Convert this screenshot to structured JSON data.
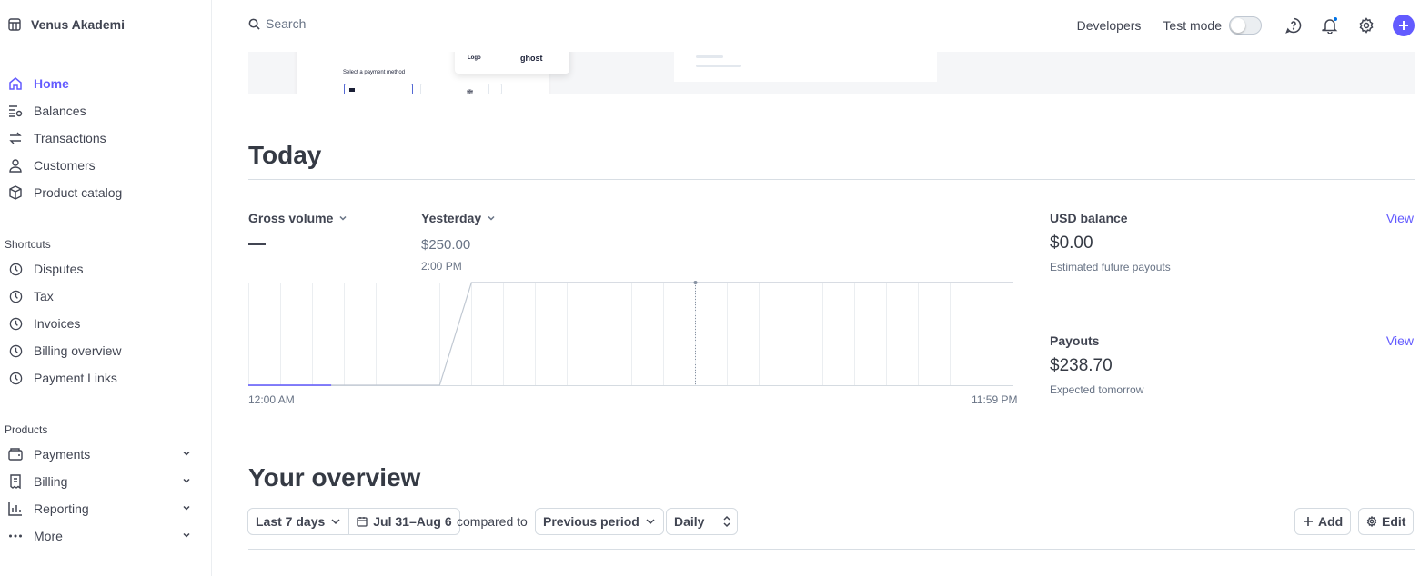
{
  "account": {
    "name": "Venus Akademi"
  },
  "nav": {
    "main": [
      {
        "label": "Home",
        "icon": "home-icon",
        "active": true
      },
      {
        "label": "Balances",
        "icon": "balances-icon"
      },
      {
        "label": "Transactions",
        "icon": "transactions-icon"
      },
      {
        "label": "Customers",
        "icon": "customers-icon"
      },
      {
        "label": "Product catalog",
        "icon": "product-catalog-icon"
      }
    ],
    "shortcuts_label": "Shortcuts",
    "shortcuts": [
      {
        "label": "Disputes",
        "icon": "clock-icon"
      },
      {
        "label": "Tax",
        "icon": "clock-icon"
      },
      {
        "label": "Invoices",
        "icon": "clock-icon"
      },
      {
        "label": "Billing overview",
        "icon": "clock-icon"
      },
      {
        "label": "Payment Links",
        "icon": "clock-icon"
      }
    ],
    "products_label": "Products",
    "products": [
      {
        "label": "Payments",
        "icon": "wallet-icon"
      },
      {
        "label": "Billing",
        "icon": "billing-icon"
      },
      {
        "label": "Reporting",
        "icon": "reporting-icon"
      },
      {
        "label": "More",
        "icon": "more-icon"
      }
    ]
  },
  "topbar": {
    "search_placeholder": "Search",
    "developers": "Developers",
    "test_mode": "Test mode",
    "test_mode_on": false
  },
  "banner": {
    "payment_method_text": "Select a payment method",
    "logo_text": "Logo",
    "brand_text": "ghost"
  },
  "today": {
    "heading": "Today",
    "metric_label": "Gross volume",
    "metric_value": "—",
    "compare_label": "Yesterday",
    "compare_value": "$250.00",
    "compare_time": "2:00 PM",
    "x_start": "12:00 AM",
    "x_end": "11:59 PM"
  },
  "chart_data": {
    "type": "line",
    "title": "",
    "x_range": [
      "12:00 AM",
      "11:59 PM"
    ],
    "grid": true,
    "series": [
      {
        "name": "Gross volume",
        "color": "#635bff",
        "x_hours": [
          0,
          2.6
        ],
        "values": [
          0,
          0
        ]
      },
      {
        "name": "Yesterday",
        "color": "#c0c8d2",
        "x_hours": [
          0,
          6,
          7,
          24
        ],
        "values": [
          0,
          0,
          250,
          250
        ]
      }
    ],
    "hover_hour": 14,
    "hover_value": 250
  },
  "balance": {
    "title": "USD balance",
    "view": "View",
    "value": "$0.00",
    "sub": "Estimated future payouts"
  },
  "payouts": {
    "title": "Payouts",
    "view": "View",
    "value": "$238.70",
    "sub": "Expected tomorrow"
  },
  "overview": {
    "heading": "Your overview",
    "range": "Last 7 days",
    "dates": "Jul 31–Aug 6",
    "compared_to": "compared to",
    "comparison": "Previous period",
    "granularity": "Daily",
    "add": "Add",
    "edit": "Edit"
  },
  "colors": {
    "accent": "#635bff",
    "text": "#414552",
    "muted": "#687385"
  }
}
